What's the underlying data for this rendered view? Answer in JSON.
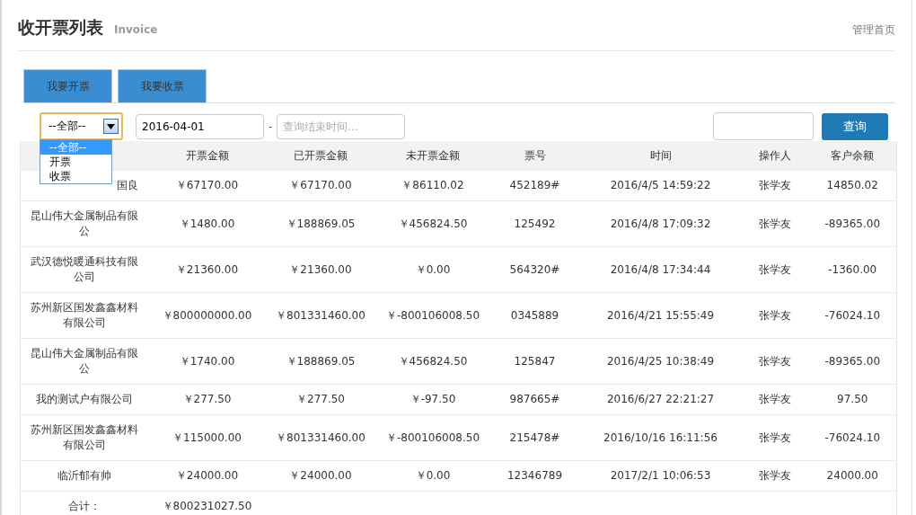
{
  "page": {
    "title": "收开票列表",
    "subtitle": "Invoice",
    "home_link": "管理首页"
  },
  "tabs": [
    {
      "label": "我要开票"
    },
    {
      "label": "我要收票"
    }
  ],
  "filter": {
    "type_select": {
      "value": "--全部--",
      "expanded": true,
      "options": [
        {
          "label": "--全部--",
          "selected": true
        },
        {
          "label": "开票",
          "selected": false
        },
        {
          "label": "收票",
          "selected": false
        }
      ]
    },
    "start_date": {
      "value": "2016-04-01"
    },
    "separator": "-",
    "end_date": {
      "placeholder": "查询结束时间..."
    },
    "search_button": "查询"
  },
  "table": {
    "columns": [
      "",
      "开票金额",
      "已开票金额",
      "未开票金额",
      "票号",
      "时间",
      "操作人",
      "客户余额"
    ],
    "rows": [
      [
        "国良",
        "￥67170.00",
        "￥67170.00",
        "￥86110.02",
        "452189#",
        "2016/4/5 14:59:22",
        "张学友",
        "14850.02"
      ],
      [
        "昆山伟大金属制品有限公",
        "￥1480.00",
        "￥188869.05",
        "￥456824.50",
        "125492",
        "2016/4/8 17:09:32",
        "张学友",
        "-89365.00"
      ],
      [
        "武汉德悦暖通科技有限公司",
        "￥21360.00",
        "￥21360.00",
        "￥0.00",
        "564320#",
        "2016/4/8 17:34:44",
        "张学友",
        "-1360.00"
      ],
      [
        "苏州新区国发鑫鑫材料有限公司",
        "￥800000000.00",
        "￥801331460.00",
        "￥-800106008.50",
        "0345889",
        "2016/4/21 15:55:49",
        "张学友",
        "-76024.10"
      ],
      [
        "昆山伟大金属制品有限公",
        "￥1740.00",
        "￥188869.05",
        "￥456824.50",
        "125847",
        "2016/4/25 10:38:49",
        "张学友",
        "-89365.00"
      ],
      [
        "我的测试户有限公司",
        "￥277.50",
        "￥277.50",
        "￥-97.50",
        "987665#",
        "2016/6/27 22:21:27",
        "张学友",
        "97.50"
      ],
      [
        "苏州新区国发鑫鑫材料有限公司",
        "￥115000.00",
        "￥801331460.00",
        "￥-800106008.50",
        "215478#",
        "2016/10/16 16:11:56",
        "张学友",
        "-76024.10"
      ],
      [
        "临沂郁有帅",
        "￥24000.00",
        "￥24000.00",
        "￥0.00",
        "12346789",
        "2017/2/1 10:06:53",
        "张学友",
        "24000.00"
      ]
    ],
    "total": {
      "label": "合计：",
      "amount": "￥800231027.50"
    }
  }
}
